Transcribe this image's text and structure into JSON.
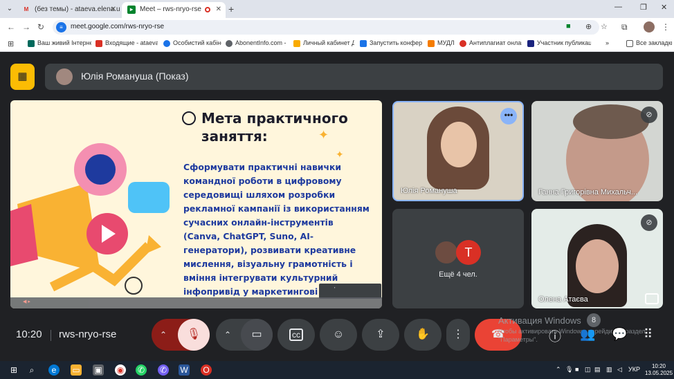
{
  "browser": {
    "tabs": [
      {
        "label": "(без темы) - ataeva.elena.uipac",
        "active": false
      },
      {
        "label": "Meet – rws-nryo-rse",
        "active": true
      }
    ],
    "url": "meet.google.com/rws-nryo-rse",
    "bookmarks": [
      "Ваш живий Інтерне...",
      "Входящие - ataeva...",
      "Особистий кабінет",
      "AbonentInfo.com -...",
      "Личный кабинет Д...",
      "Запустить конфере...",
      "МУДЛ",
      "Антиплагиат онлай...",
      "Участник публикац..."
    ],
    "all_bookmarks": "Все закладки"
  },
  "meet": {
    "presenter": "Юлія Романуша (Показ)",
    "slide": {
      "title": "Мета практичного заняття:",
      "body": "Сформувати практичні навички командної роботи в цифровому середовищі шляхом розробки рекламної кампанії із використанням сучасних онлайн-інструментів (Canva, ChatGPT, Suno, AI-генератори), розвивати креативне мислення, візуальну грамотність і вміння інтегрувати культурний інфопривід у маркетингові стратегії."
    },
    "participants": [
      {
        "name": "Юлія Романуша"
      },
      {
        "name": "Ганна Григорівна Михальч..."
      },
      {
        "name": "Олена Атаєва"
      }
    ],
    "more_initial": "Т",
    "more_label": "Ещё 4 чел.",
    "time": "10:20",
    "code": "rws-nryo-rse",
    "people_count": "8",
    "activation_title": "Активация Windows",
    "activation_text": "Чтобы активировать Windows, перейдите в раздел \"Параметры\"."
  },
  "taskbar": {
    "lang": "УКР",
    "time": "10:20",
    "date": "13.05.2025"
  },
  "colors": {
    "accent_yellow": "#fbbc04",
    "hangup_red": "#ea4335",
    "meet_bg": "#202124",
    "slide_text_blue": "#1e3a9e"
  }
}
